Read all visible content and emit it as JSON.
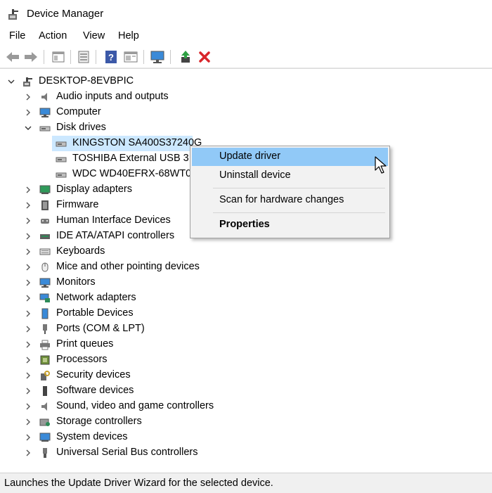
{
  "window": {
    "title": "Device Manager",
    "icon": "device-manager-icon"
  },
  "menu": [
    "File",
    "Action",
    "View",
    "Help"
  ],
  "toolbar": [
    "back-icon",
    "forward-icon",
    "properties-pane-icon",
    "device-icon",
    "help-icon",
    "view-icon",
    "monitor-scan-icon",
    "update-driver-icon",
    "uninstall-icon"
  ],
  "tree": {
    "root": "DESKTOP-8EVBPIC",
    "categories": [
      {
        "label": "Audio inputs and outputs",
        "icon": "speaker-icon"
      },
      {
        "label": "Computer",
        "icon": "computer-icon"
      },
      {
        "label": "Disk drives",
        "icon": "disk-icon",
        "expanded": true
      },
      {
        "label": "Display adapters",
        "icon": "display-adapter-icon"
      },
      {
        "label": "Firmware",
        "icon": "firmware-icon"
      },
      {
        "label": "Human Interface Devices",
        "icon": "hid-icon"
      },
      {
        "label": "IDE ATA/ATAPI controllers",
        "icon": "ide-icon"
      },
      {
        "label": "Keyboards",
        "icon": "keyboard-icon"
      },
      {
        "label": "Mice and other pointing devices",
        "icon": "mouse-icon"
      },
      {
        "label": "Monitors",
        "icon": "monitor-icon"
      },
      {
        "label": "Network adapters",
        "icon": "network-icon"
      },
      {
        "label": "Portable Devices",
        "icon": "portable-icon"
      },
      {
        "label": "Ports (COM & LPT)",
        "icon": "port-icon"
      },
      {
        "label": "Print queues",
        "icon": "printer-icon"
      },
      {
        "label": "Processors",
        "icon": "processor-icon"
      },
      {
        "label": "Security devices",
        "icon": "security-icon"
      },
      {
        "label": "Software devices",
        "icon": "software-icon"
      },
      {
        "label": "Sound, video and game controllers",
        "icon": "sound-icon"
      },
      {
        "label": "Storage controllers",
        "icon": "storage-icon"
      },
      {
        "label": "System devices",
        "icon": "system-icon"
      },
      {
        "label": "Universal Serial Bus controllers",
        "icon": "usb-icon"
      }
    ],
    "disks": [
      "KINGSTON SA400S37240G",
      "TOSHIBA External USB 3.0",
      "WDC WD40EFRX-68WT0N"
    ]
  },
  "context_menu": {
    "update": "Update driver",
    "uninstall": "Uninstall device",
    "scan": "Scan for hardware changes",
    "properties": "Properties"
  },
  "status": "Launches the Update Driver Wizard for the selected device.",
  "colors": {
    "selection": "#cce8ff",
    "menu_highlight": "#91c9f7",
    "uninstall": "#d9262b"
  }
}
